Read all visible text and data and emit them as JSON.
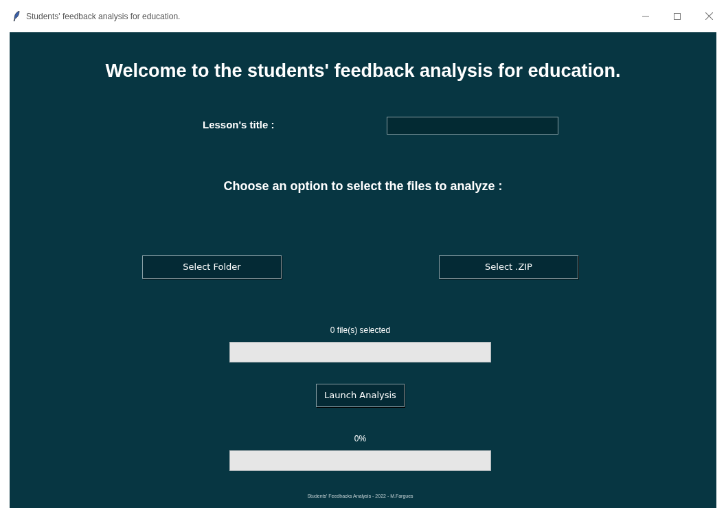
{
  "window": {
    "title": "Students' feedback analysis for education."
  },
  "heading": "Welcome to the students' feedback analysis for education.",
  "lesson": {
    "label": "Lesson's title :"
  },
  "prompt": "Choose an option to select the files to analyze :",
  "buttons": [
    "Select Folder",
    "Select .ZIP"
  ],
  "files": {
    "status": "0 file(s) selected",
    "level": 0
  },
  "launch_button": "Launch Analysis",
  "analysis": {
    "status": "0%",
    "level": 0
  },
  "footer": "Students' Feedbacks Analysis - 2022 - M.Fargues"
}
